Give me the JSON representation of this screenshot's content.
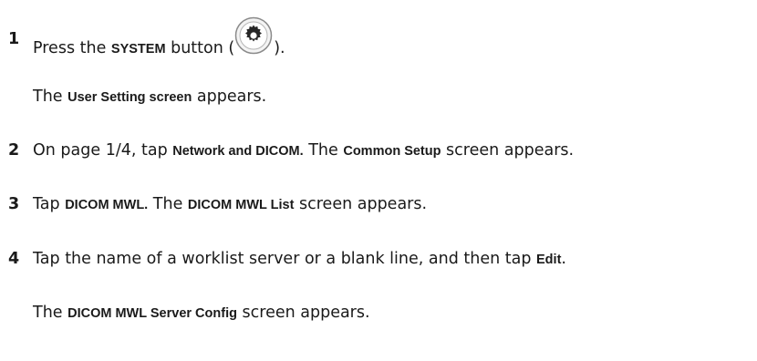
{
  "steps": [
    {
      "number": "1",
      "parts": [
        "Press the ",
        "SYSTEM",
        " button (",
        ")."
      ],
      "icon": "gear-icon"
    },
    {
      "note_parts": [
        "The ",
        "User Setting screen",
        " appears."
      ]
    },
    {
      "number": "2",
      "parts": [
        "On page 1/4, tap ",
        "Network and DICOM.",
        " The ",
        "Common Setup",
        " screen appears."
      ]
    },
    {
      "number": "3",
      "parts": [
        "Tap ",
        "DICOM MWL.",
        " The ",
        "DICOM MWL List",
        " screen appears."
      ]
    },
    {
      "number": "4",
      "parts": [
        "Tap the name of a worklist server or a blank line, and then tap ",
        "Edit",
        "."
      ]
    },
    {
      "note_parts": [
        "The ",
        "DICOM MWL Server Config",
        " screen appears."
      ]
    }
  ]
}
